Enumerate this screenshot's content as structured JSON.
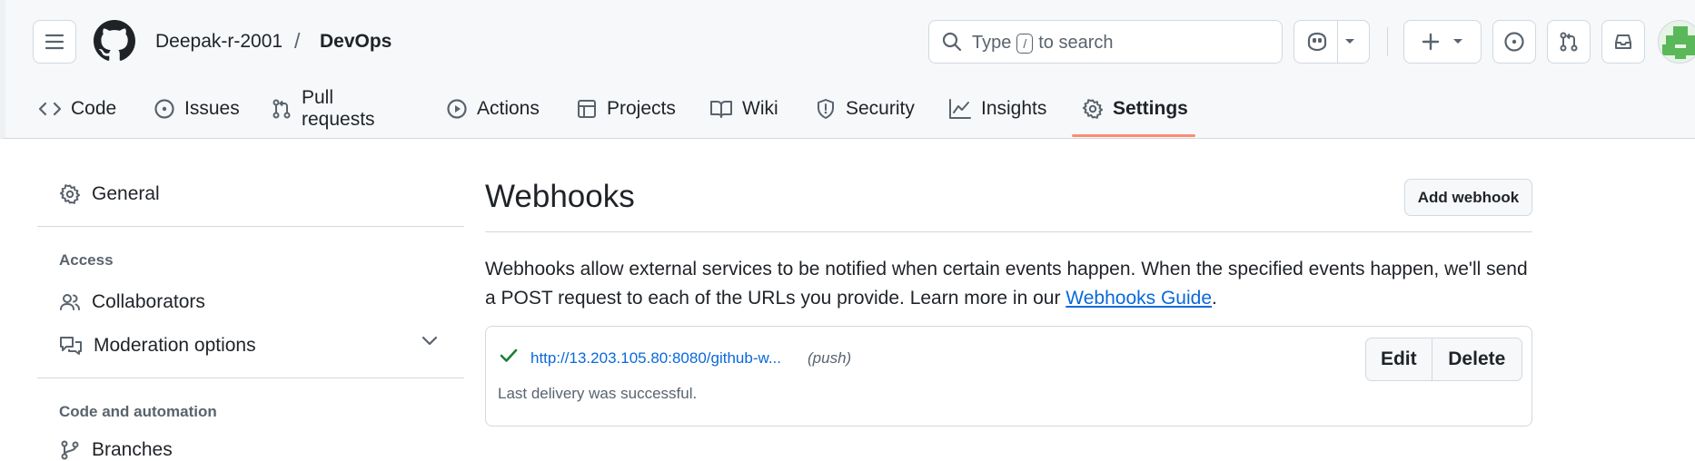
{
  "header": {
    "owner": "Deepak-r-2001",
    "separator": "/",
    "repo": "DevOps",
    "search": {
      "before": "Type",
      "key": "/",
      "after": "to search"
    }
  },
  "tabs": [
    {
      "label": "Code",
      "icon": "code-icon"
    },
    {
      "label": "Issues",
      "icon": "issue-opened-icon"
    },
    {
      "label": "Pull requests",
      "icon": "git-pull-request-icon"
    },
    {
      "label": "Actions",
      "icon": "play-icon"
    },
    {
      "label": "Projects",
      "icon": "table-icon"
    },
    {
      "label": "Wiki",
      "icon": "book-icon"
    },
    {
      "label": "Security",
      "icon": "shield-icon"
    },
    {
      "label": "Insights",
      "icon": "graph-icon"
    },
    {
      "label": "Settings",
      "icon": "gear-icon",
      "selected": true
    }
  ],
  "sidebar": {
    "general": "General",
    "access_heading": "Access",
    "collaborators": "Collaborators",
    "moderation": "Moderation options",
    "code_heading": "Code and automation",
    "branches": "Branches"
  },
  "main": {
    "title": "Webhooks",
    "add_button": "Add webhook",
    "description": "Webhooks allow external services to be notified when certain events happen. When the specified events happen, we'll send a POST request to each of the URLs you provide. Learn more in our ",
    "guide_link": "Webhooks Guide",
    "description_end": ".",
    "webhook": {
      "url": "http://13.203.105.80:8080/github-w...",
      "event": "(push)",
      "status": "Last delivery was successful.",
      "edit": "Edit",
      "delete": "Delete"
    }
  },
  "colors": {
    "accent_underline": "#fd8c73",
    "link": "#0969da",
    "success": "#1a7f37"
  }
}
